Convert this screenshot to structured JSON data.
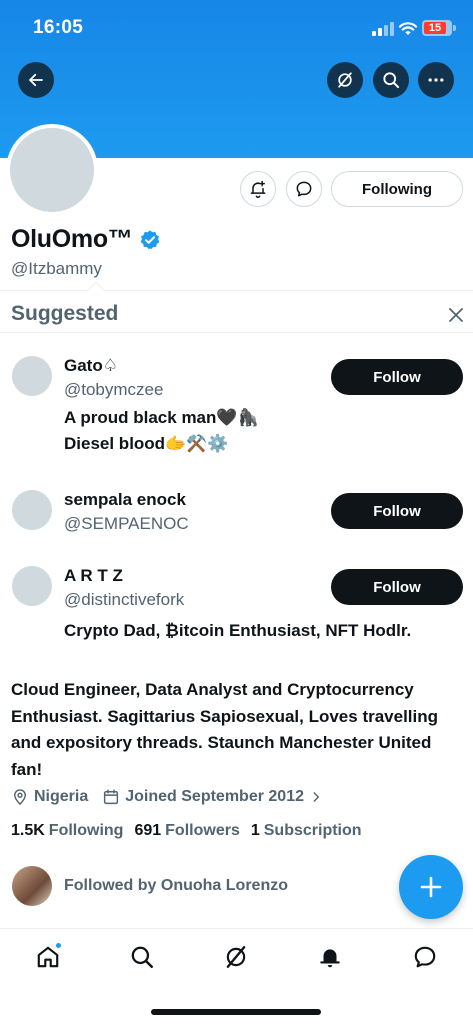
{
  "status_bar": {
    "time": "16:05",
    "battery": "15"
  },
  "icons": {
    "back": "arrow-left-icon",
    "grok": "grok-icon",
    "search": "search-icon",
    "more": "more-horizontal-icon",
    "notify": "bell-plus-icon",
    "message": "message-icon",
    "verified": "verified-badge-icon",
    "close": "close-icon",
    "location": "location-pin-icon",
    "calendar": "calendar-icon",
    "chevron": "chevron-right-icon",
    "compose": "plus-icon",
    "nav_home": "home-icon",
    "nav_search": "search-icon",
    "nav_grok": "grok-icon",
    "nav_notifications": "bell-icon",
    "nav_messages": "message-icon"
  },
  "colors": {
    "banner": "#1d9bf0",
    "accent": "#1d9bf0",
    "follow_button": "#0f1419",
    "verified": "#1d9bf0"
  },
  "profile": {
    "name": "OluOmo™",
    "handle": "@Itzbammy",
    "following_button": "Following",
    "bio": "Cloud Engineer, Data Analyst and Cryptocurrency Enthusiast. Sagittarius Sapiosexual, Loves travelling and expository threads. Staunch Manchester United fan!",
    "location": "Nigeria",
    "joined": "Joined September 2012",
    "stats": {
      "following_count": "1.5K",
      "following_label": "Following",
      "followers_count": "691",
      "followers_label": "Followers",
      "subscription_count": "1",
      "subscription_label": "Subscription"
    },
    "followed_by": "Followed by Onuoha Lorenzo"
  },
  "suggested": {
    "title": "Suggested",
    "items": [
      {
        "name": "Gato♤",
        "handle": "@tobymczee",
        "bio_line1": "A proud black man🖤🦍",
        "bio_line2": "Diesel blood🫱⚒️⚙️",
        "button": "Follow"
      },
      {
        "name": "sempala enock",
        "handle": "@SEMPAENOC",
        "button": "Follow"
      },
      {
        "name": "A R T Z",
        "handle": "@distinctivefork",
        "bio_line1": "Crypto Dad, ₿itcoin Enthusiast, NFT Hodlr.",
        "button": "Follow"
      }
    ]
  }
}
